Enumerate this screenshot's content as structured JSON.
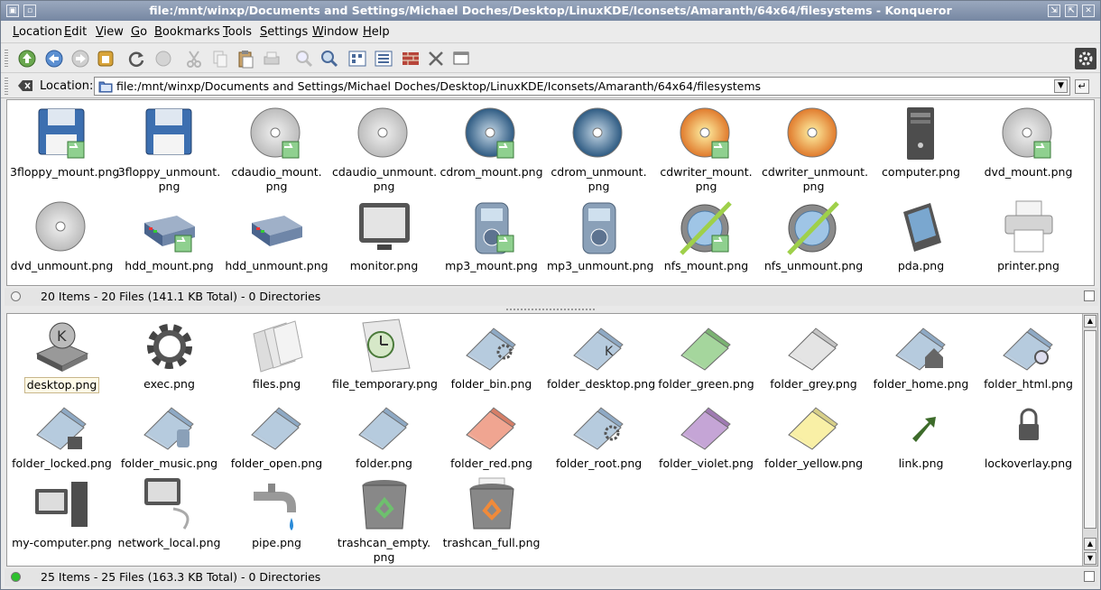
{
  "window": {
    "title": "file:/mnt/winxp/Documents and Settings/Michael Doches/Desktop/LinuxKDE/Iconsets/Amaranth/64x64/filesystems - Konqueror"
  },
  "menu": [
    "Location",
    "Edit",
    "View",
    "Go",
    "Bookmarks",
    "Tools",
    "Settings",
    "Window",
    "Help"
  ],
  "location": {
    "label": "Location:",
    "value": "file:/mnt/winxp/Documents and Settings/Michael Doches/Desktop/LinuxKDE/Iconsets/Amaranth/64x64/filesystems"
  },
  "top_pane": {
    "files": [
      {
        "name": "3floppy_mount.png",
        "l2": "",
        "icon": "floppy-mount-icon"
      },
      {
        "name": "3floppy_unmount.",
        "l2": "png",
        "icon": "floppy-icon"
      },
      {
        "name": "cdaudio_mount.",
        "l2": "png",
        "icon": "cdaudio-mount-icon"
      },
      {
        "name": "cdaudio_unmount.",
        "l2": "png",
        "icon": "cdaudio-icon"
      },
      {
        "name": "cdrom_mount.png",
        "l2": "",
        "icon": "cdrom-mount-icon"
      },
      {
        "name": "cdrom_unmount.",
        "l2": "png",
        "icon": "cdrom-icon"
      },
      {
        "name": "cdwriter_mount.",
        "l2": "png",
        "icon": "cdwriter-mount-icon"
      },
      {
        "name": "cdwriter_unmount.",
        "l2": "png",
        "icon": "cdwriter-icon"
      },
      {
        "name": "computer.png",
        "l2": "",
        "icon": "computer-tower-icon"
      },
      {
        "name": "dvd_mount.png",
        "l2": "",
        "icon": "dvd-mount-icon"
      },
      {
        "name": "dvd_unmount.png",
        "l2": "",
        "icon": "dvd-icon"
      },
      {
        "name": "hdd_mount.png",
        "l2": "",
        "icon": "hdd-mount-icon"
      },
      {
        "name": "hdd_unmount.png",
        "l2": "",
        "icon": "hdd-icon"
      },
      {
        "name": "monitor.png",
        "l2": "",
        "icon": "monitor-icon"
      },
      {
        "name": "mp3_mount.png",
        "l2": "",
        "icon": "mp3-mount-icon"
      },
      {
        "name": "mp3_unmount.png",
        "l2": "",
        "icon": "mp3-icon"
      },
      {
        "name": "nfs_mount.png",
        "l2": "",
        "icon": "nfs-mount-icon"
      },
      {
        "name": "nfs_unmount.png",
        "l2": "",
        "icon": "nfs-icon"
      },
      {
        "name": "pda.png",
        "l2": "",
        "icon": "pda-icon"
      },
      {
        "name": "printer.png",
        "l2": "",
        "icon": "printer-icon"
      }
    ],
    "status": "20 Items - 20 Files (141.1 KB Total) - 0 Directories"
  },
  "bottom_pane": {
    "files": [
      {
        "name": "desktop.png",
        "l2": "",
        "icon": "desktop-icon"
      },
      {
        "name": "exec.png",
        "l2": "",
        "icon": "gear-icon"
      },
      {
        "name": "files.png",
        "l2": "",
        "icon": "files-icon"
      },
      {
        "name": "file_temporary.png",
        "l2": "",
        "icon": "clock-file-icon"
      },
      {
        "name": "folder_bin.png",
        "l2": "",
        "icon": "folder-bin-icon"
      },
      {
        "name": "folder_desktop.png",
        "l2": "",
        "icon": "folder-desktop-icon"
      },
      {
        "name": "folder_green.png",
        "l2": "",
        "icon": "folder-green-icon"
      },
      {
        "name": "folder_grey.png",
        "l2": "",
        "icon": "folder-grey-icon"
      },
      {
        "name": "folder_home.png",
        "l2": "",
        "icon": "folder-home-icon"
      },
      {
        "name": "folder_html.png",
        "l2": "",
        "icon": "folder-html-icon"
      },
      {
        "name": "folder_locked.png",
        "l2": "",
        "icon": "folder-locked-icon"
      },
      {
        "name": "folder_music.png",
        "l2": "",
        "icon": "folder-music-icon"
      },
      {
        "name": "folder_open.png",
        "l2": "",
        "icon": "folder-open-icon"
      },
      {
        "name": "folder.png",
        "l2": "",
        "icon": "folder-icon"
      },
      {
        "name": "folder_red.png",
        "l2": "",
        "icon": "folder-red-icon"
      },
      {
        "name": "folder_root.png",
        "l2": "",
        "icon": "folder-root-icon"
      },
      {
        "name": "folder_violet.png",
        "l2": "",
        "icon": "folder-violet-icon"
      },
      {
        "name": "folder_yellow.png",
        "l2": "",
        "icon": "folder-yellow-icon"
      },
      {
        "name": "link.png",
        "l2": "",
        "icon": "link-arrow-icon"
      },
      {
        "name": "lockoverlay.png",
        "l2": "",
        "icon": "lock-icon"
      },
      {
        "name": "my-computer.png",
        "l2": "",
        "icon": "my-computer-icon"
      },
      {
        "name": "network_local.png",
        "l2": "",
        "icon": "network-local-icon"
      },
      {
        "name": "pipe.png",
        "l2": "",
        "icon": "pipe-icon"
      },
      {
        "name": "trashcan_empty.",
        "l2": "png",
        "icon": "trashcan-empty-icon"
      },
      {
        "name": "trashcan_full.png",
        "l2": "",
        "icon": "trashcan-full-icon"
      }
    ],
    "selected": "desktop.png",
    "status": "25 Items - 25 Files (163.3 KB Total) - 0 Directories"
  }
}
